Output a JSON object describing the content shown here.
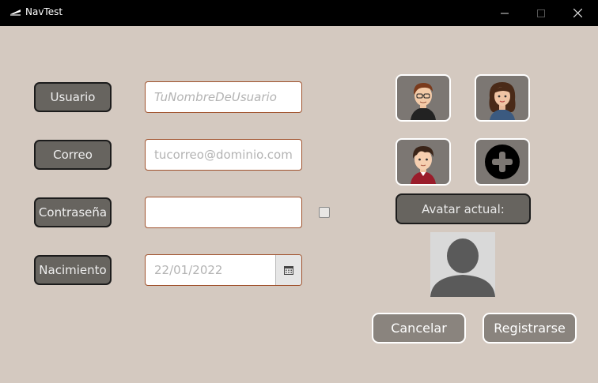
{
  "window": {
    "title": "NavTest"
  },
  "form": {
    "usuario": {
      "label": "Usuario",
      "placeholder": "TuNombreDeUsuario"
    },
    "correo": {
      "label": "Correo",
      "placeholder": "tucorreo@dominio.com"
    },
    "contrasena": {
      "label": "Contraseña",
      "value": ""
    },
    "nacimiento": {
      "label": "Nacimiento",
      "placeholder": "22/01/2022"
    }
  },
  "avatars": {
    "options": [
      "avatar-man-glasses",
      "avatar-woman",
      "avatar-boy",
      "add-avatar"
    ],
    "current_label": "Avatar actual:"
  },
  "actions": {
    "cancel_label": "Cancelar",
    "register_label": "Registrarse"
  },
  "colors": {
    "background": "#d4c9c0",
    "label_bg": "#67645f",
    "field_border": "#a0522d",
    "button_bg": "#8a847e"
  }
}
